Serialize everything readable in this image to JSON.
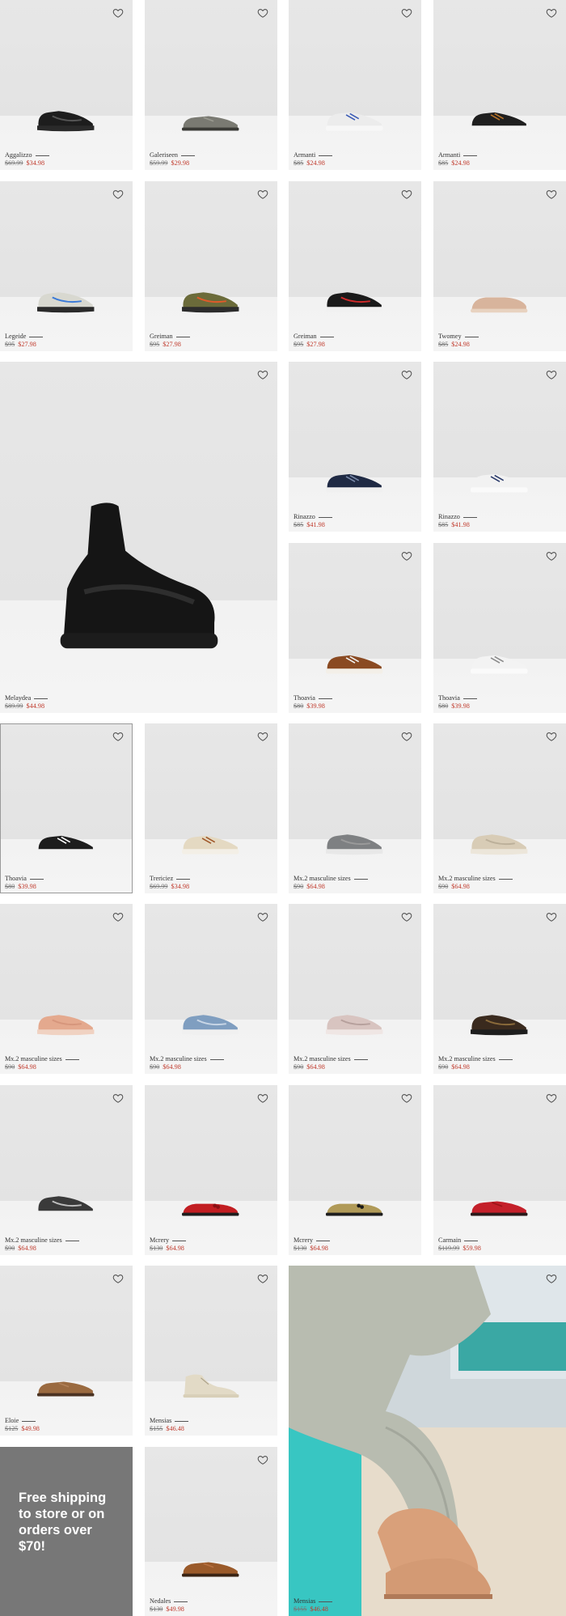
{
  "heart_icon": "heart-outline-icon",
  "colors": {
    "sale_price": "#c0392b",
    "promo_bg": "#777777"
  },
  "products": [
    {
      "name": "Aggalizzo",
      "was": "$69.99",
      "now": "$34.98",
      "shoe": "black-knit-sneaker"
    },
    {
      "name": "Galeriseen",
      "was": "$59.99",
      "now": "$29.98",
      "shoe": "grey-oxford"
    },
    {
      "name": "Armanti",
      "was": "$85",
      "now": "$24.98",
      "shoe": "white-sneaker"
    },
    {
      "name": "Armanti",
      "was": "$85",
      "now": "$24.98",
      "shoe": "black-white-sneaker"
    },
    {
      "name": "Legeide",
      "was": "$95",
      "now": "$27.98",
      "shoe": "white-blue-runner"
    },
    {
      "name": "Greiman",
      "was": "$95",
      "now": "$27.98",
      "shoe": "olive-runner"
    },
    {
      "name": "Greiman",
      "was": "$95",
      "now": "$27.98",
      "shoe": "black-red-runner"
    },
    {
      "name": "Twomey",
      "was": "$85",
      "now": "$24.98",
      "shoe": "blush-slipon"
    },
    {
      "name": "Melaydea",
      "was": "$89.99",
      "now": "$44.98",
      "shoe": "black-sock-boot"
    },
    {
      "name": "Rinazzo",
      "was": "$85",
      "now": "$41.98",
      "shoe": "navy-sneaker"
    },
    {
      "name": "Rinazzo",
      "was": "$85",
      "now": "$41.98",
      "shoe": "white-navy-sneaker"
    },
    {
      "name": "Thoavia",
      "was": "$80",
      "now": "$39.98",
      "shoe": "cognac-sneaker"
    },
    {
      "name": "Thoavia",
      "was": "$80",
      "now": "$39.98",
      "shoe": "white-grey-sneaker"
    },
    {
      "name": "Thoavia",
      "was": "$80",
      "now": "$39.98",
      "shoe": "black-white-stripe-sneaker"
    },
    {
      "name": "Trericiez",
      "was": "$69.99",
      "now": "$34.98",
      "shoe": "beige-sneaker"
    },
    {
      "name": "Mx.2 masculine sizes",
      "was": "$90",
      "now": "$64.98",
      "shoe": "grey-knit"
    },
    {
      "name": "Mx.2 masculine sizes",
      "was": "$90",
      "now": "$64.98",
      "shoe": "beige-knit"
    },
    {
      "name": "Mx.2 masculine sizes",
      "was": "$90",
      "now": "$64.98",
      "shoe": "peach-knit"
    },
    {
      "name": "Mx.2 masculine sizes",
      "was": "$90",
      "now": "$64.98",
      "shoe": "blue-knit"
    },
    {
      "name": "Mx.2 masculine sizes",
      "was": "$90",
      "now": "$64.98",
      "shoe": "pink-knit"
    },
    {
      "name": "Mx.2 masculine sizes",
      "was": "$90",
      "now": "$64.98",
      "shoe": "leopard-knit"
    },
    {
      "name": "Mx.2 masculine sizes",
      "was": "$90",
      "now": "$64.98",
      "shoe": "black-white-knit"
    },
    {
      "name": "Mcrery",
      "was": "$130",
      "now": "$64.98",
      "shoe": "red-loafer"
    },
    {
      "name": "Mcrery",
      "was": "$130",
      "now": "$64.98",
      "shoe": "gold-glitter-loafer"
    },
    {
      "name": "Carmain",
      "was": "$119.99",
      "now": "$59.98",
      "shoe": "red-derby"
    },
    {
      "name": "Eloie",
      "was": "$125",
      "now": "$49.98",
      "shoe": "tan-suede-brogue"
    },
    {
      "name": "Mensias",
      "was": "$155",
      "now": "$46.48",
      "shoe": "cream-chukka"
    },
    {
      "name": "Nedales",
      "was": "$130",
      "now": "$49.98",
      "shoe": "cognac-derby"
    },
    {
      "name": "Mensias",
      "was": "$155",
      "now": "$46.48",
      "shoe": "lifestyle-photo"
    }
  ],
  "promo": {
    "text": "Free shipping to store or on orders over $70!"
  }
}
